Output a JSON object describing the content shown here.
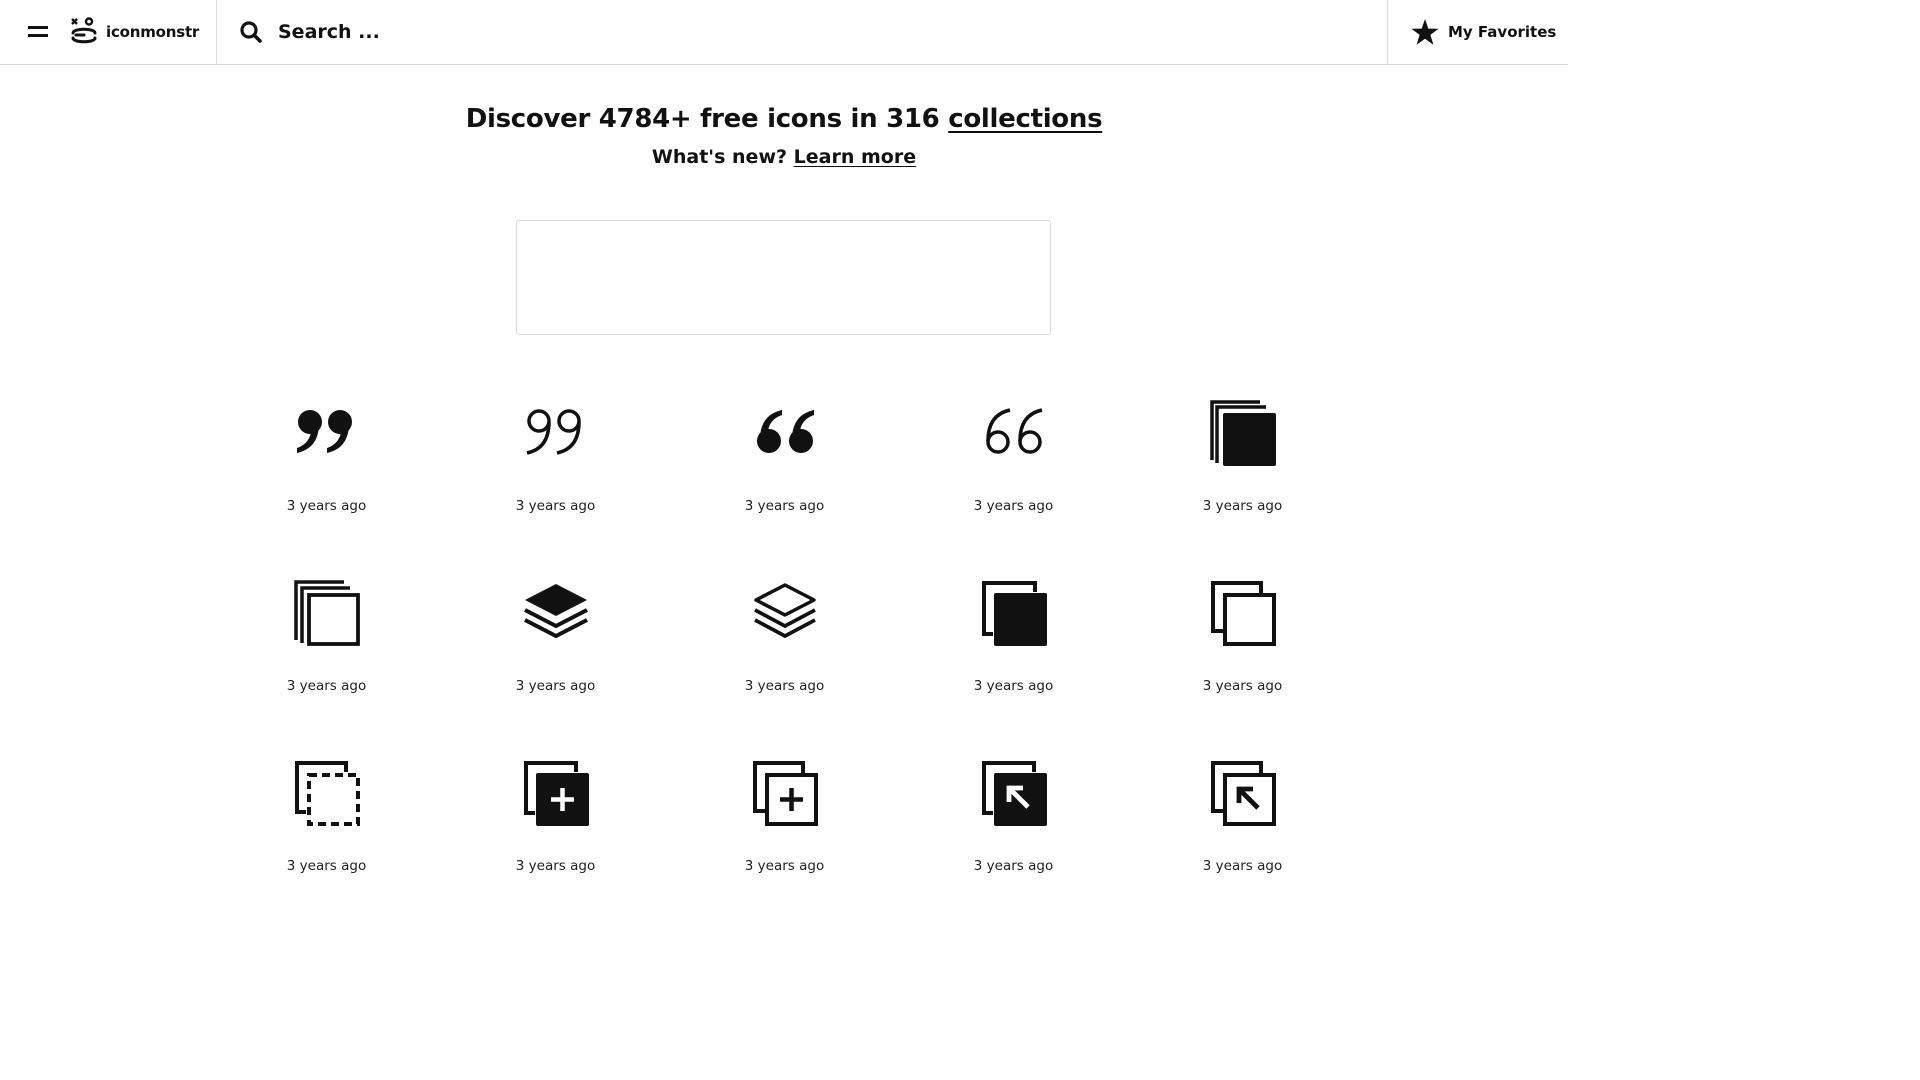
{
  "header": {
    "brand": "iconmonstr",
    "search_placeholder": "Search ...",
    "favorites_label": "My Favorites"
  },
  "hero": {
    "title_prefix": "Discover 4784+ free icons in 316 ",
    "title_link": "collections",
    "subtitle_prefix": "What's new? ",
    "subtitle_link": "Learn more"
  },
  "icons": [
    {
      "name": "quote-closing-filled-icon",
      "meta": "3 years ago"
    },
    {
      "name": "quote-closing-outline-icon",
      "meta": "3 years ago"
    },
    {
      "name": "quote-opening-filled-icon",
      "meta": "3 years ago"
    },
    {
      "name": "quote-opening-outline-icon",
      "meta": "3 years ago"
    },
    {
      "name": "stacked-squares-filled-icon",
      "meta": "3 years ago"
    },
    {
      "name": "stacked-squares-outline-icon",
      "meta": "3 years ago"
    },
    {
      "name": "layers-filled-icon",
      "meta": "3 years ago"
    },
    {
      "name": "layers-outline-icon",
      "meta": "3 years ago"
    },
    {
      "name": "copy-filled-icon",
      "meta": "3 years ago"
    },
    {
      "name": "copy-outline-icon",
      "meta": "3 years ago"
    },
    {
      "name": "copy-dashed-icon",
      "meta": "3 years ago"
    },
    {
      "name": "copy-add-filled-icon",
      "meta": "3 years ago"
    },
    {
      "name": "copy-add-outline-icon",
      "meta": "3 years ago"
    },
    {
      "name": "copy-arrow-filled-icon",
      "meta": "3 years ago"
    },
    {
      "name": "copy-arrow-outline-icon",
      "meta": "3 years ago"
    }
  ]
}
